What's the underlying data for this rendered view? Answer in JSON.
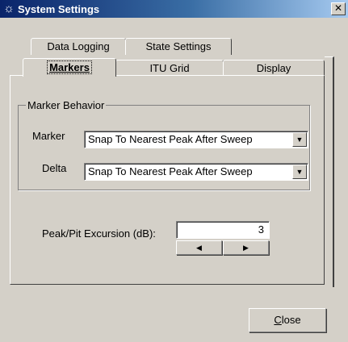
{
  "window": {
    "title": "System Settings",
    "icon": "sun-gear-icon",
    "close_glyph": "✕"
  },
  "tabs_row_back": [
    {
      "label": "Data Logging"
    },
    {
      "label": "State Settings"
    }
  ],
  "tabs_row_front": [
    {
      "label": "Markers",
      "active": true
    },
    {
      "label": "ITU Grid"
    },
    {
      "label": "Display"
    }
  ],
  "marker_behavior": {
    "legend": "Marker Behavior",
    "marker_label": "Marker",
    "marker_value": "Snap To Nearest Peak After Sweep",
    "delta_label": "Delta",
    "delta_value": "Snap To Nearest Peak After Sweep",
    "dropdown_glyph": "▼"
  },
  "excursion": {
    "label": "Peak/Pit Excursion (dB):",
    "value": "3",
    "decrement_glyph": "◀",
    "increment_glyph": "▶"
  },
  "buttons": {
    "close_prefix": "",
    "close_mnemonic": "C",
    "close_rest": "lose"
  }
}
